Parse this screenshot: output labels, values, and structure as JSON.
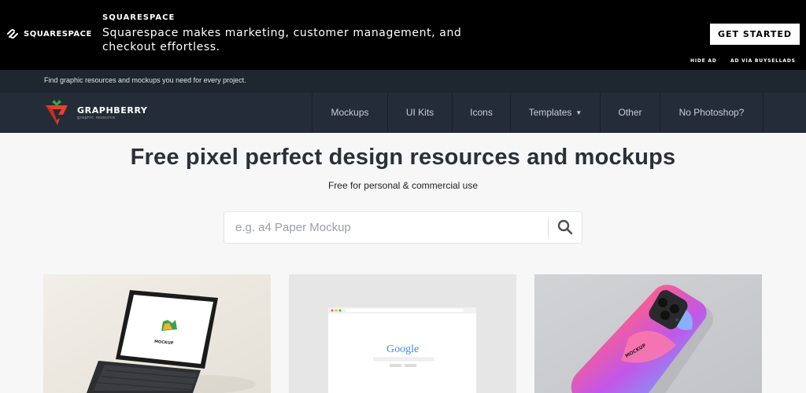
{
  "ad": {
    "logo_text": "SQUARESPACE",
    "brand": "SQUARESPACE",
    "copy": "Squarespace makes marketing, customer management, and checkout effortless.",
    "cta": "GET STARTED",
    "hide": "HIDE AD",
    "via": "AD VIA BUYSELLADS"
  },
  "topbar": {
    "text": "Find graphic resources and mockups you need for every project."
  },
  "nav": {
    "brand_name": "GRAPHBERRY",
    "brand_tagline": "graphic resource",
    "items": [
      {
        "label": "Mockups"
      },
      {
        "label": "UI Kits"
      },
      {
        "label": "Icons"
      },
      {
        "label": "Templates"
      },
      {
        "label": "Other"
      },
      {
        "label": "No Photoshop?"
      }
    ]
  },
  "hero": {
    "title": "Free pixel perfect design resources and mockups",
    "subtitle": "Free for personal & commercial use"
  },
  "search": {
    "placeholder": "e.g. a4 Paper Mockup",
    "value": ""
  },
  "cards": [
    {
      "mockup_text": "MOCKUP"
    },
    {
      "mockup_text": "Google"
    },
    {
      "mockup_text": "MOCKUP"
    }
  ],
  "colors": {
    "ad_bg": "#000000",
    "topbar_bg": "#1e2630",
    "nav_bg": "#242c38",
    "brand_red": "#e8402b",
    "brand_green": "#3aa14a"
  }
}
